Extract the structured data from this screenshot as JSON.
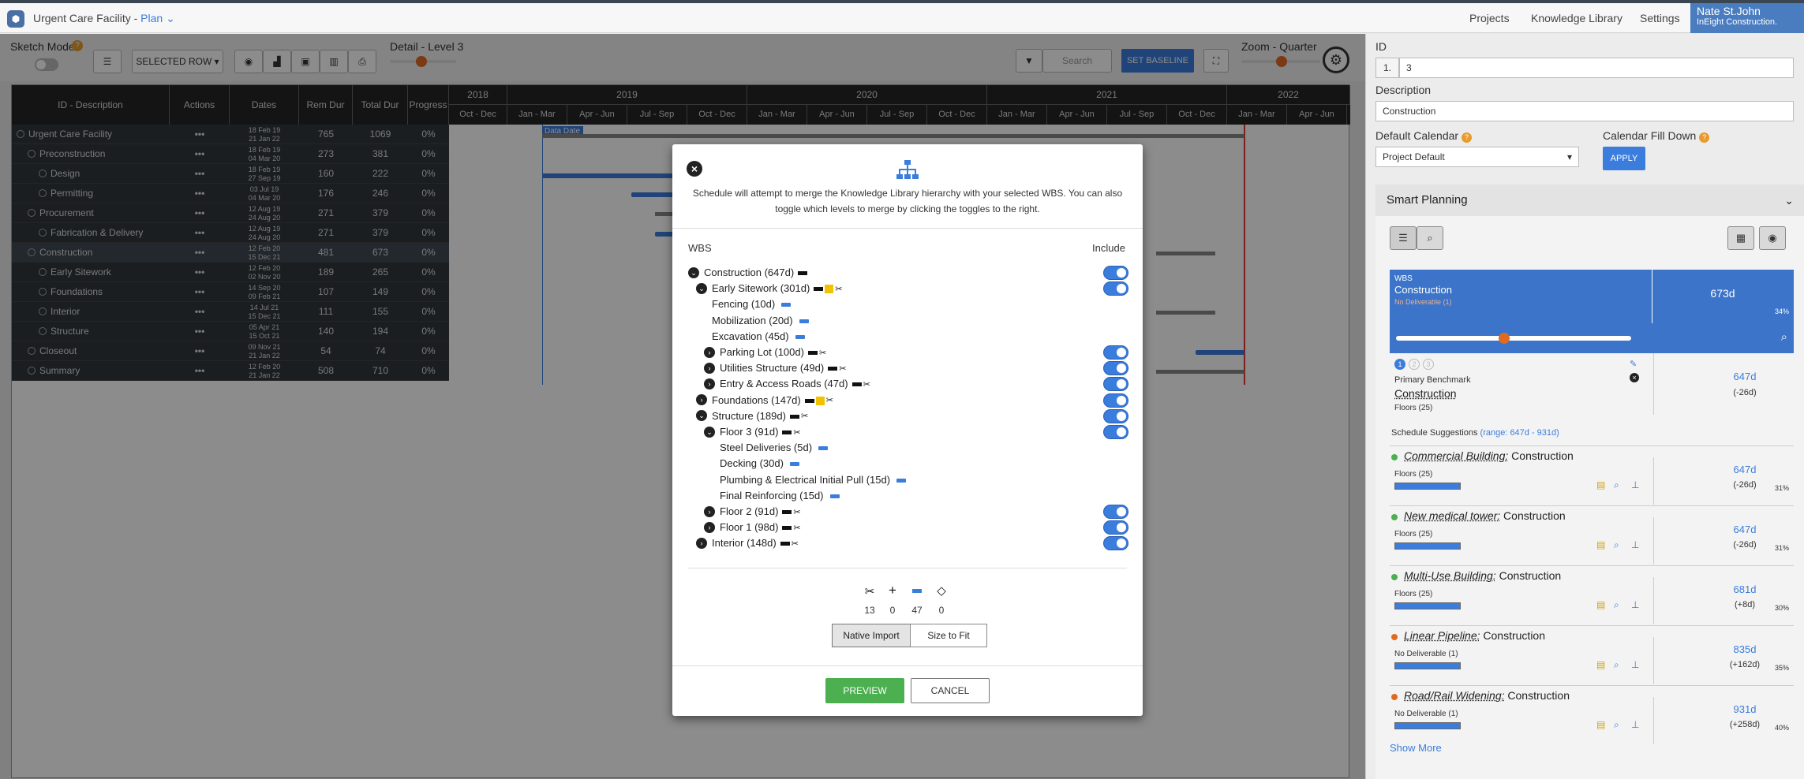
{
  "app": {
    "title": "Urgent Care Facility -",
    "mode": "Plan"
  },
  "nav": {
    "projects": "Projects",
    "knowledge": "Knowledge Library",
    "settings": "Settings"
  },
  "user": {
    "name": "Nate St.John",
    "company": "InEight Construction."
  },
  "toolbar": {
    "sketch_mode": "Sketch Mode",
    "selected_row": "SELECTED ROW",
    "detail_label": "Detail - Level 3",
    "search_placeholder": "Search",
    "set_baseline": "SET BASELINE",
    "zoom_label": "Zoom - Quarter"
  },
  "grid": {
    "columns": [
      "ID - Description",
      "Actions",
      "Dates",
      "Rem Dur",
      "Total Dur",
      "Progress"
    ],
    "years": [
      "2018",
      "2019",
      "2020",
      "2021",
      "2022"
    ],
    "quarters": [
      "Oct - Dec",
      "Jan - Mar",
      "Apr - Jun",
      "Jul - Sep",
      "Oct - Dec",
      "Jan - Mar",
      "Apr - Jun",
      "Jul - Sep",
      "Oct - Dec",
      "Jan - Mar",
      "Apr - Jun",
      "Jul - Sep",
      "Oct - Dec",
      "Jan - Mar",
      "Apr - Jun"
    ],
    "data_date": "Data Date",
    "rows": [
      {
        "name": "Urgent Care Facility",
        "start": "18 Feb 19",
        "end": "21 Jan 22",
        "rem": "765",
        "total": "1069",
        "progress": "0%"
      },
      {
        "name": "Preconstruction",
        "start": "18 Feb 19",
        "end": "04 Mar 20",
        "rem": "273",
        "total": "381",
        "progress": "0%"
      },
      {
        "name": "Design",
        "start": "18 Feb 19",
        "end": "27 Sep 19",
        "rem": "160",
        "total": "222",
        "progress": "0%"
      },
      {
        "name": "Permitting",
        "start": "03 Jul 19",
        "end": "04 Mar 20",
        "rem": "176",
        "total": "246",
        "progress": "0%"
      },
      {
        "name": "Procurement",
        "start": "12 Aug 19",
        "end": "24 Aug 20",
        "rem": "271",
        "total": "379",
        "progress": "0%"
      },
      {
        "name": "Fabrication & Delivery",
        "start": "12 Aug 19",
        "end": "24 Aug 20",
        "rem": "271",
        "total": "379",
        "progress": "0%"
      },
      {
        "name": "Construction",
        "start": "12 Feb 20",
        "end": "15 Dec 21",
        "rem": "481",
        "total": "673",
        "progress": "0%"
      },
      {
        "name": "Early Sitework",
        "start": "12 Feb 20",
        "end": "02 Nov 20",
        "rem": "189",
        "total": "265",
        "progress": "0%"
      },
      {
        "name": "Foundations",
        "start": "14 Sep 20",
        "end": "09 Feb 21",
        "rem": "107",
        "total": "149",
        "progress": "0%"
      },
      {
        "name": "Interior",
        "start": "14 Jul 21",
        "end": "15 Dec 21",
        "rem": "111",
        "total": "155",
        "progress": "0%"
      },
      {
        "name": "Structure",
        "start": "05 Apr 21",
        "end": "15 Oct 21",
        "rem": "140",
        "total": "194",
        "progress": "0%"
      },
      {
        "name": "Closeout",
        "start": "09 Nov 21",
        "end": "21 Jan 22",
        "rem": "54",
        "total": "74",
        "progress": "0%"
      },
      {
        "name": "Summary",
        "start": "12 Feb 20",
        "end": "21 Jan 22",
        "rem": "508",
        "total": "710",
        "progress": "0%"
      }
    ]
  },
  "modal": {
    "intro": "Schedule will attempt to merge the Knowledge Library hierarchy with your selected WBS. You can also toggle which levels to merge by clicking the toggles to the right.",
    "wbs_header": "WBS",
    "include_header": "Include",
    "items": [
      {
        "label": "Construction (647d)"
      },
      {
        "label": "Early Sitework (301d)"
      },
      {
        "label": "Fencing (10d)"
      },
      {
        "label": "Mobilization (20d)"
      },
      {
        "label": "Excavation (45d)"
      },
      {
        "label": "Parking Lot (100d)"
      },
      {
        "label": "Utilities Structure (49d)"
      },
      {
        "label": "Entry & Access Roads (47d)"
      },
      {
        "label": "Foundations (147d)"
      },
      {
        "label": "Structure (189d)"
      },
      {
        "label": "Floor 3 (91d)"
      },
      {
        "label": "Steel Deliveries (5d)"
      },
      {
        "label": "Decking (30d)"
      },
      {
        "label": "Plumbing & Electrical Initial Pull (15d)"
      },
      {
        "label": "Final Reinforcing (15d)"
      },
      {
        "label": "Floor 2 (91d)"
      },
      {
        "label": "Floor 1 (98d)"
      },
      {
        "label": "Interior (148d)"
      }
    ],
    "counts": {
      "merge": "13",
      "add": "0",
      "activity": "47",
      "milestone": "0"
    },
    "native_import": "Native Import",
    "size_to_fit": "Size to Fit",
    "preview": "PREVIEW",
    "cancel": "CANCEL"
  },
  "right_panel": {
    "id_label": "ID",
    "id_prefix": "1.",
    "id_value": "3",
    "desc_label": "Description",
    "desc_value": "Construction",
    "cal_label": "Default Calendar",
    "cal_value": "Project Default",
    "fill_label": "Calendar Fill Down",
    "apply": "APPLY",
    "smart_planning": "Smart Planning",
    "wbs_card": {
      "tag": "WBS",
      "name": "Construction",
      "sub": "No Deliverable (1)",
      "dur": "673d",
      "pct": "34%"
    },
    "benchmark": {
      "label": "Primary Benchmark",
      "name": "Construction",
      "floors": "Floors (25)",
      "dur": "647d",
      "var": "(-26d)"
    },
    "suggestions_title": "Schedule Suggestions",
    "suggestions_range": "(range: 647d - 931d)",
    "suggestions": [
      {
        "project": "Commercial Building:",
        "wbs": "Construction",
        "sub": "Floors (25)",
        "dur": "647d",
        "var": "(-26d)",
        "pct": "31%"
      },
      {
        "project": "New medical tower:",
        "wbs": "Construction",
        "sub": "Floors (25)",
        "dur": "647d",
        "var": "(-26d)",
        "pct": "31%"
      },
      {
        "project": "Multi-Use Building:",
        "wbs": "Construction",
        "sub": "Floors (25)",
        "dur": "681d",
        "var": "(+8d)",
        "pct": "30%"
      },
      {
        "project": "Linear Pipeline:",
        "wbs": "Construction",
        "sub": "No Deliverable (1)",
        "dur": "835d",
        "var": "(+162d)",
        "pct": "35%"
      },
      {
        "project": "Road/Rail Widening:",
        "wbs": "Construction",
        "sub": "No Deliverable (1)",
        "dur": "931d",
        "var": "(+258d)",
        "pct": "40%"
      }
    ],
    "show_more": "Show More"
  },
  "colors": {
    "accent": "#3b7ddd",
    "preview": "#4caf50",
    "header": "#262626",
    "orange": "#e06a22"
  }
}
